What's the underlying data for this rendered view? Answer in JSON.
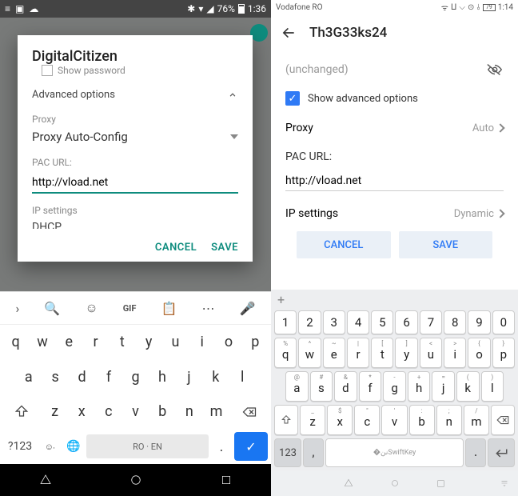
{
  "left": {
    "status": {
      "battery": "76%",
      "time": "1:36"
    },
    "dialog": {
      "title": "DigitalCitizen",
      "show_password": "Show password",
      "advanced_options": "Advanced options",
      "proxy_label": "Proxy",
      "proxy_value": "Proxy Auto-Config",
      "pac_label": "PAC URL:",
      "pac_value": "http://vload.net",
      "ip_settings": "IP settings",
      "cancel": "CANCEL",
      "save": "SAVE"
    },
    "keyboard": {
      "row1": [
        "q",
        "w",
        "e",
        "r",
        "t",
        "y",
        "u",
        "i",
        "o",
        "p"
      ],
      "row2": [
        "a",
        "s",
        "d",
        "f",
        "g",
        "h",
        "j",
        "k",
        "l"
      ],
      "row3": [
        "z",
        "x",
        "c",
        "v",
        "b",
        "n",
        "m"
      ],
      "symkey": "?123",
      "space": "RO · EN",
      "gif": "GIF"
    }
  },
  "right": {
    "status": {
      "carrier": "Vodafone RO",
      "battery": "79",
      "time": "1:14"
    },
    "header": {
      "title": "Th3G33ks24"
    },
    "body": {
      "unchanged": "(unchanged)",
      "show_advanced": "Show advanced options",
      "proxy_label": "Proxy",
      "proxy_value": "Auto",
      "pac_label": "PAC URL:",
      "pac_value": "http://vload.net",
      "ip_label": "IP settings",
      "ip_value": "Dynamic",
      "cancel": "CANCEL",
      "save": "SAVE"
    },
    "keyboard": {
      "nums": [
        "1",
        "2",
        "3",
        "4",
        "5",
        "6",
        "7",
        "8",
        "9",
        "0"
      ],
      "r1_sup": [
        "%",
        "^",
        "~",
        "|",
        "[",
        "]",
        "<",
        ">",
        "{",
        "}"
      ],
      "r1": [
        "q",
        "w",
        "e",
        "r",
        "t",
        "y",
        "u",
        "i",
        "o",
        "p"
      ],
      "r2_sup": [
        "@",
        "#",
        "&",
        "*",
        "-",
        "+",
        "=",
        "(",
        ")"
      ],
      "r2": [
        "a",
        "s",
        "d",
        "f",
        "g",
        "h",
        "j",
        "k",
        "l"
      ],
      "r3_sup": [
        "_",
        "$",
        "\"",
        "'",
        ":",
        ";",
        "/"
      ],
      "r3": [
        "z",
        "x",
        "c",
        "v",
        "b",
        "n",
        "m"
      ],
      "key123": "123",
      "space": "SwiftKey"
    }
  }
}
